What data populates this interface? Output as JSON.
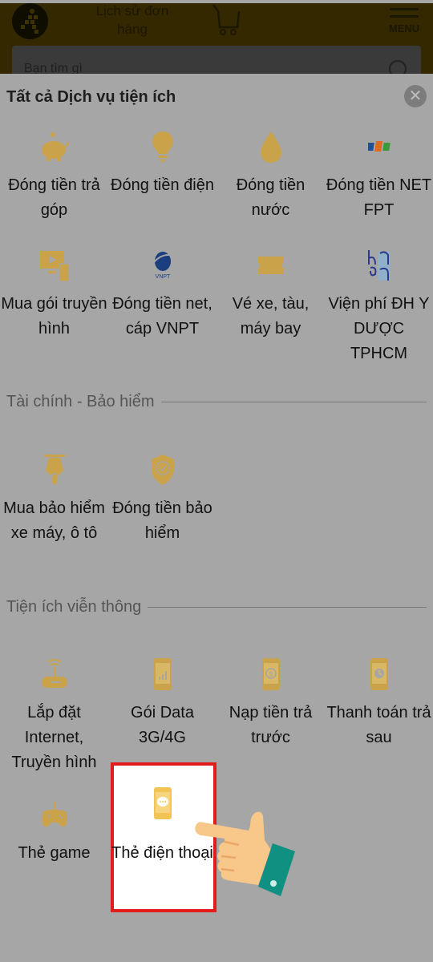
{
  "header": {
    "order_history": "Lịch sử đơn hàng",
    "menu_label": "MENU",
    "search_placeholder": "Bạn tìm gì"
  },
  "panel": {
    "title": "Tất cả Dịch vụ tiện ích",
    "close_icon": "close-icon",
    "all_services": [
      {
        "label": "Đóng tiền trả góp",
        "icon": "piggy-bank-icon"
      },
      {
        "label": "Đóng tiền điện",
        "icon": "lightbulb-icon"
      },
      {
        "label": "Đóng tiền nước",
        "icon": "water-drop-icon"
      },
      {
        "label": "Đóng tiền NET FPT",
        "icon": "fpt-logo-icon"
      },
      {
        "label": "Mua gói truyền hình",
        "icon": "tv-device-icon"
      },
      {
        "label": "Đóng tiền net, cáp VNPT",
        "icon": "vnpt-logo-icon"
      },
      {
        "label": "Vé xe, tàu, máy bay",
        "icon": "ticket-icon"
      },
      {
        "label": "Viện phí ĐH Y DƯỢC TPHCM",
        "icon": "university-logo-icon"
      }
    ],
    "sections": [
      {
        "title": "Tài chính - Bảo hiểm",
        "items": [
          {
            "label": "Mua bảo hiểm xe máy, ô tô",
            "icon": "motorbike-icon"
          },
          {
            "label": "Đóng tiền bảo hiểm",
            "icon": "shield-check-icon"
          }
        ]
      },
      {
        "title": "Tiện ích viễn thông",
        "items": [
          {
            "label": "Lắp đặt Internet, Truyền hình",
            "icon": "router-icon"
          },
          {
            "label": "Gói Data 3G/4G",
            "icon": "phone-signal-icon"
          },
          {
            "label": "Nạp tiền trả trước",
            "icon": "phone-dollar-icon"
          },
          {
            "label": "Thanh toán trả sau",
            "icon": "phone-clock-icon"
          },
          {
            "label": "Thẻ game",
            "icon": "gamepad-icon"
          },
          {
            "label": "Thẻ điện thoại",
            "icon": "phone-chat-icon",
            "highlighted": true
          }
        ]
      }
    ]
  },
  "colors": {
    "icon_gold": "#c9a24a",
    "highlight_border": "#e31b1b",
    "overlay": "#a6a6a6"
  }
}
